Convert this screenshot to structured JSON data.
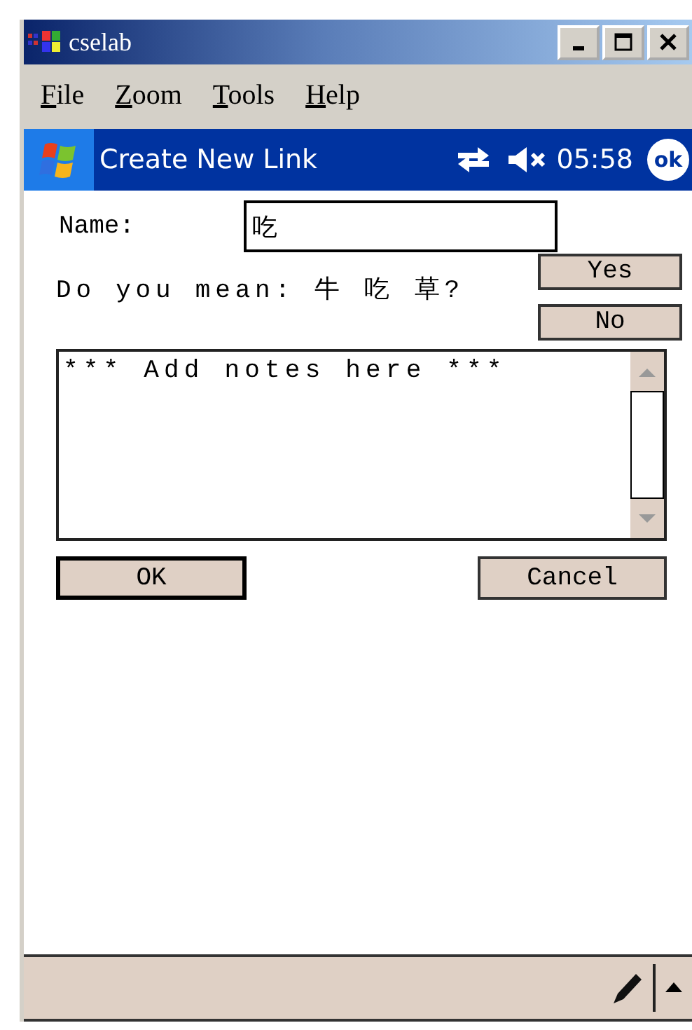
{
  "window": {
    "title": "cselab"
  },
  "menu": [
    "File",
    "Zoom",
    "Tools",
    "Help"
  ],
  "nav_bar": {
    "title": "Create New Link",
    "time": "05:58",
    "ok": "ok"
  },
  "form": {
    "name_label": "Name:",
    "name_value": "吃",
    "question": "Do you mean: 牛 吃 草?",
    "yes": "Yes",
    "no": "No",
    "notes": "*** Add notes here ***",
    "ok": "OK",
    "cancel": "Cancel"
  }
}
